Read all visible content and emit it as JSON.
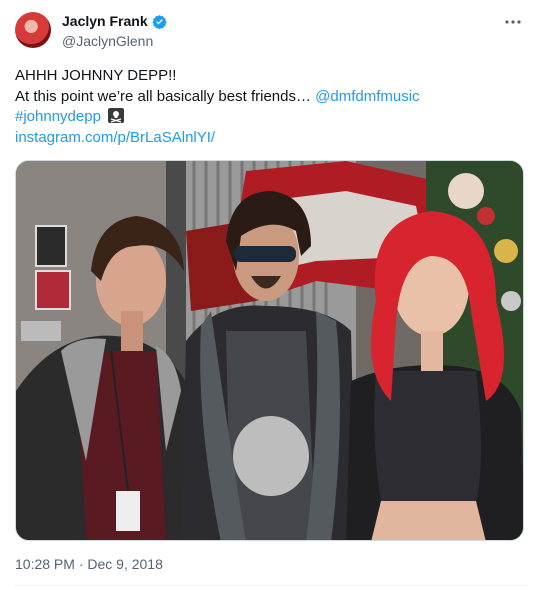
{
  "author": {
    "display_name": "Jaclyn Frank",
    "handle": "@JaclynGlenn",
    "verified": true
  },
  "tweet": {
    "line1": "AHHH JOHNNY DEPP!!",
    "line2_text": "At this point we’re all basically best friends… ",
    "line2_mention": "@dmfdmfmusic",
    "hashtag": "#johnnydepp",
    "emoji_icon": "pirate-flag-icon",
    "url": "instagram.com/p/BrLaSAlnlYI/",
    "timestamp": "10:28 PM · Dec 9, 2018"
  },
  "media": {
    "description_icon": "photo"
  },
  "colors": {
    "link": "#1d9bf0",
    "secondary_text": "#536471",
    "verified": "#1d9bf0"
  }
}
